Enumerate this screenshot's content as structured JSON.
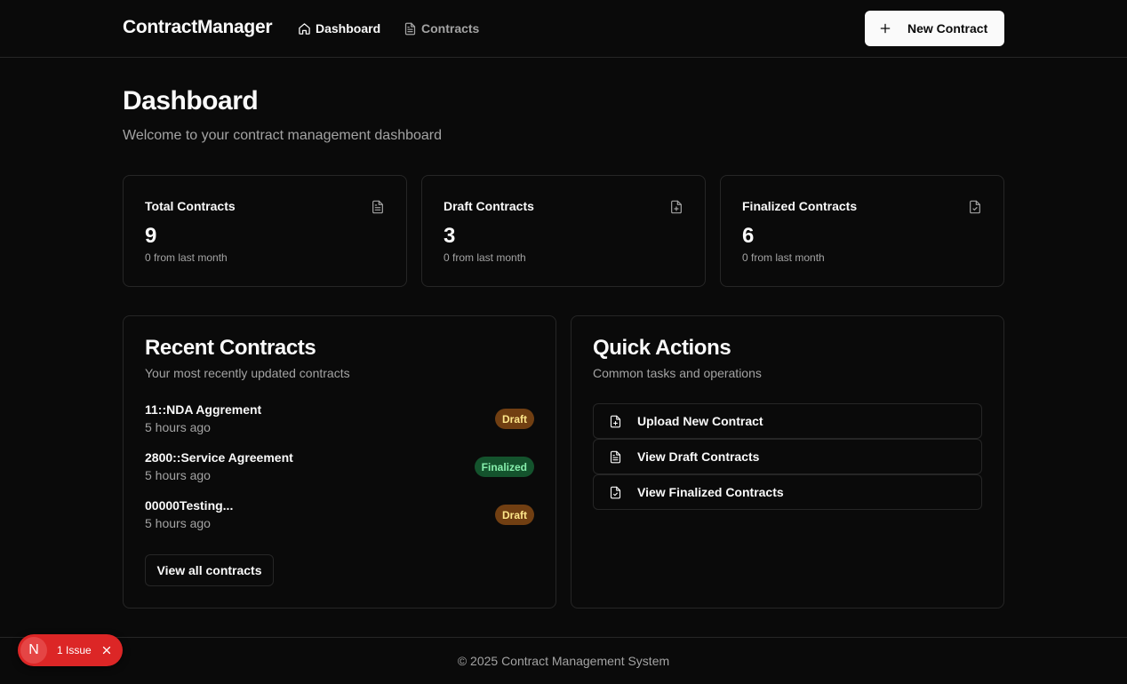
{
  "header": {
    "brand": "ContractManager",
    "nav": [
      {
        "label": "Dashboard",
        "icon": "home-icon"
      },
      {
        "label": "Contracts",
        "icon": "document-icon"
      }
    ],
    "new_contract_label": "New Contract",
    "new_contract_icon": "plus-icon"
  },
  "page": {
    "title": "Dashboard",
    "subtitle": "Welcome to your contract management dashboard"
  },
  "stats": [
    {
      "title": "Total Contracts",
      "value": "9",
      "change": "0 from last month",
      "icon": "document-icon"
    },
    {
      "title": "Draft Contracts",
      "value": "3",
      "change": "0 from last month",
      "icon": "file-plus-icon"
    },
    {
      "title": "Finalized Contracts",
      "value": "6",
      "change": "0 from last month",
      "icon": "file-check-icon"
    }
  ],
  "recent": {
    "title": "Recent Contracts",
    "subtitle": "Your most recently updated contracts",
    "items": [
      {
        "name": "11::NDA Aggrement",
        "time": "5 hours ago",
        "status": "Draft"
      },
      {
        "name": "2800::Service Agreement",
        "time": "5 hours ago",
        "status": "Finalized"
      },
      {
        "name": "00000Testing...",
        "time": "5 hours ago",
        "status": "Draft"
      }
    ],
    "view_all_label": "View all contracts"
  },
  "quick_actions": {
    "title": "Quick Actions",
    "subtitle": "Common tasks and operations",
    "actions": [
      {
        "label": "Upload New Contract",
        "icon": "file-plus-icon"
      },
      {
        "label": "View Draft Contracts",
        "icon": "document-icon"
      },
      {
        "label": "View Finalized Contracts",
        "icon": "file-check-icon"
      }
    ]
  },
  "footer": {
    "text": "© 2025 Contract Management System"
  },
  "issue_indicator": {
    "logo": "N",
    "text": "1 Issue"
  },
  "colors": {
    "background": "#0a0a0a",
    "border": "#262626",
    "draft_badge": "#713f12",
    "finalized_badge": "#14532d",
    "issue_red": "#dc2626"
  }
}
